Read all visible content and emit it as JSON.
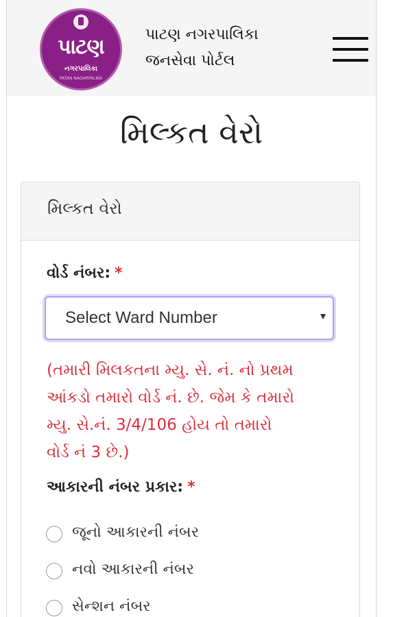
{
  "header": {
    "logo": {
      "main_text": "પાટણ",
      "sub_text": "નગરપાલિકા",
      "small_text": "PATAN NAGARPALIKA",
      "brand_color": "#8a1f86",
      "emblem_icon": "state-emblem-icon"
    },
    "title_line1": "પાટણ નગરપાલિકા",
    "title_line2": "જનસેવા પોર્ટલ",
    "menu_icon": "hamburger-menu-icon"
  },
  "page": {
    "title": "મિલ્કત વેરો"
  },
  "card": {
    "header": "મિલ્કત વેરો",
    "ward": {
      "label": "વોર્ડ નંબર:",
      "required_marker": "*",
      "select_value": "Select Ward Number",
      "arrow_icon": "caret-down-icon"
    },
    "hint": {
      "line1": "(તમારી મિલકતના મ્યુ. સે. નં. નો પ્રથમ",
      "line2": "આંકડો તમારો વોર્ડ નં. છે. જેમ કે તમારો",
      "line3": "મ્યુ. સે.નં. 3/4/106 હોય તો તમારો",
      "line4": "વોર્ડ નં 3 છે.)",
      "color": "#d9303a"
    },
    "type": {
      "label": "આકારની નંબર પ્રકાર:",
      "required_marker": "*",
      "options": [
        {
          "label": "જૂનો આકારની નંબર"
        },
        {
          "label": "નવો આકારની નંબર"
        },
        {
          "label": "સેન્શન નંબર"
        }
      ]
    }
  },
  "colors": {
    "required": "#dd3333",
    "focus_ring": "#a8a2ef",
    "header_bg": "#f5f5f5"
  }
}
